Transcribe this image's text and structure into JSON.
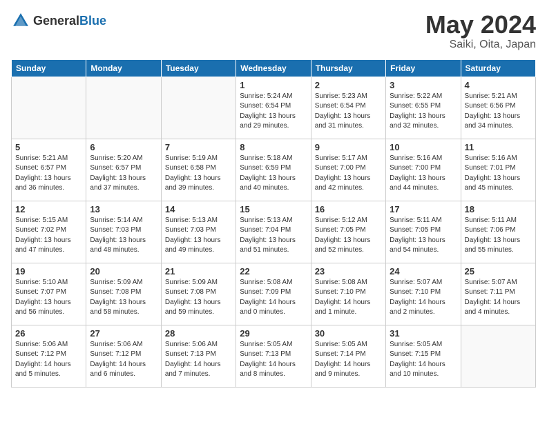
{
  "header": {
    "logo_general": "General",
    "logo_blue": "Blue",
    "month_year": "May 2024",
    "location": "Saiki, Oita, Japan"
  },
  "weekdays": [
    "Sunday",
    "Monday",
    "Tuesday",
    "Wednesday",
    "Thursday",
    "Friday",
    "Saturday"
  ],
  "weeks": [
    [
      {
        "day": "",
        "info": ""
      },
      {
        "day": "",
        "info": ""
      },
      {
        "day": "",
        "info": ""
      },
      {
        "day": "1",
        "info": "Sunrise: 5:24 AM\nSunset: 6:54 PM\nDaylight: 13 hours\nand 29 minutes."
      },
      {
        "day": "2",
        "info": "Sunrise: 5:23 AM\nSunset: 6:54 PM\nDaylight: 13 hours\nand 31 minutes."
      },
      {
        "day": "3",
        "info": "Sunrise: 5:22 AM\nSunset: 6:55 PM\nDaylight: 13 hours\nand 32 minutes."
      },
      {
        "day": "4",
        "info": "Sunrise: 5:21 AM\nSunset: 6:56 PM\nDaylight: 13 hours\nand 34 minutes."
      }
    ],
    [
      {
        "day": "5",
        "info": "Sunrise: 5:21 AM\nSunset: 6:57 PM\nDaylight: 13 hours\nand 36 minutes."
      },
      {
        "day": "6",
        "info": "Sunrise: 5:20 AM\nSunset: 6:57 PM\nDaylight: 13 hours\nand 37 minutes."
      },
      {
        "day": "7",
        "info": "Sunrise: 5:19 AM\nSunset: 6:58 PM\nDaylight: 13 hours\nand 39 minutes."
      },
      {
        "day": "8",
        "info": "Sunrise: 5:18 AM\nSunset: 6:59 PM\nDaylight: 13 hours\nand 40 minutes."
      },
      {
        "day": "9",
        "info": "Sunrise: 5:17 AM\nSunset: 7:00 PM\nDaylight: 13 hours\nand 42 minutes."
      },
      {
        "day": "10",
        "info": "Sunrise: 5:16 AM\nSunset: 7:00 PM\nDaylight: 13 hours\nand 44 minutes."
      },
      {
        "day": "11",
        "info": "Sunrise: 5:16 AM\nSunset: 7:01 PM\nDaylight: 13 hours\nand 45 minutes."
      }
    ],
    [
      {
        "day": "12",
        "info": "Sunrise: 5:15 AM\nSunset: 7:02 PM\nDaylight: 13 hours\nand 47 minutes."
      },
      {
        "day": "13",
        "info": "Sunrise: 5:14 AM\nSunset: 7:03 PM\nDaylight: 13 hours\nand 48 minutes."
      },
      {
        "day": "14",
        "info": "Sunrise: 5:13 AM\nSunset: 7:03 PM\nDaylight: 13 hours\nand 49 minutes."
      },
      {
        "day": "15",
        "info": "Sunrise: 5:13 AM\nSunset: 7:04 PM\nDaylight: 13 hours\nand 51 minutes."
      },
      {
        "day": "16",
        "info": "Sunrise: 5:12 AM\nSunset: 7:05 PM\nDaylight: 13 hours\nand 52 minutes."
      },
      {
        "day": "17",
        "info": "Sunrise: 5:11 AM\nSunset: 7:05 PM\nDaylight: 13 hours\nand 54 minutes."
      },
      {
        "day": "18",
        "info": "Sunrise: 5:11 AM\nSunset: 7:06 PM\nDaylight: 13 hours\nand 55 minutes."
      }
    ],
    [
      {
        "day": "19",
        "info": "Sunrise: 5:10 AM\nSunset: 7:07 PM\nDaylight: 13 hours\nand 56 minutes."
      },
      {
        "day": "20",
        "info": "Sunrise: 5:09 AM\nSunset: 7:08 PM\nDaylight: 13 hours\nand 58 minutes."
      },
      {
        "day": "21",
        "info": "Sunrise: 5:09 AM\nSunset: 7:08 PM\nDaylight: 13 hours\nand 59 minutes."
      },
      {
        "day": "22",
        "info": "Sunrise: 5:08 AM\nSunset: 7:09 PM\nDaylight: 14 hours\nand 0 minutes."
      },
      {
        "day": "23",
        "info": "Sunrise: 5:08 AM\nSunset: 7:10 PM\nDaylight: 14 hours\nand 1 minute."
      },
      {
        "day": "24",
        "info": "Sunrise: 5:07 AM\nSunset: 7:10 PM\nDaylight: 14 hours\nand 2 minutes."
      },
      {
        "day": "25",
        "info": "Sunrise: 5:07 AM\nSunset: 7:11 PM\nDaylight: 14 hours\nand 4 minutes."
      }
    ],
    [
      {
        "day": "26",
        "info": "Sunrise: 5:06 AM\nSunset: 7:12 PM\nDaylight: 14 hours\nand 5 minutes."
      },
      {
        "day": "27",
        "info": "Sunrise: 5:06 AM\nSunset: 7:12 PM\nDaylight: 14 hours\nand 6 minutes."
      },
      {
        "day": "28",
        "info": "Sunrise: 5:06 AM\nSunset: 7:13 PM\nDaylight: 14 hours\nand 7 minutes."
      },
      {
        "day": "29",
        "info": "Sunrise: 5:05 AM\nSunset: 7:13 PM\nDaylight: 14 hours\nand 8 minutes."
      },
      {
        "day": "30",
        "info": "Sunrise: 5:05 AM\nSunset: 7:14 PM\nDaylight: 14 hours\nand 9 minutes."
      },
      {
        "day": "31",
        "info": "Sunrise: 5:05 AM\nSunset: 7:15 PM\nDaylight: 14 hours\nand 10 minutes."
      },
      {
        "day": "",
        "info": ""
      }
    ]
  ]
}
